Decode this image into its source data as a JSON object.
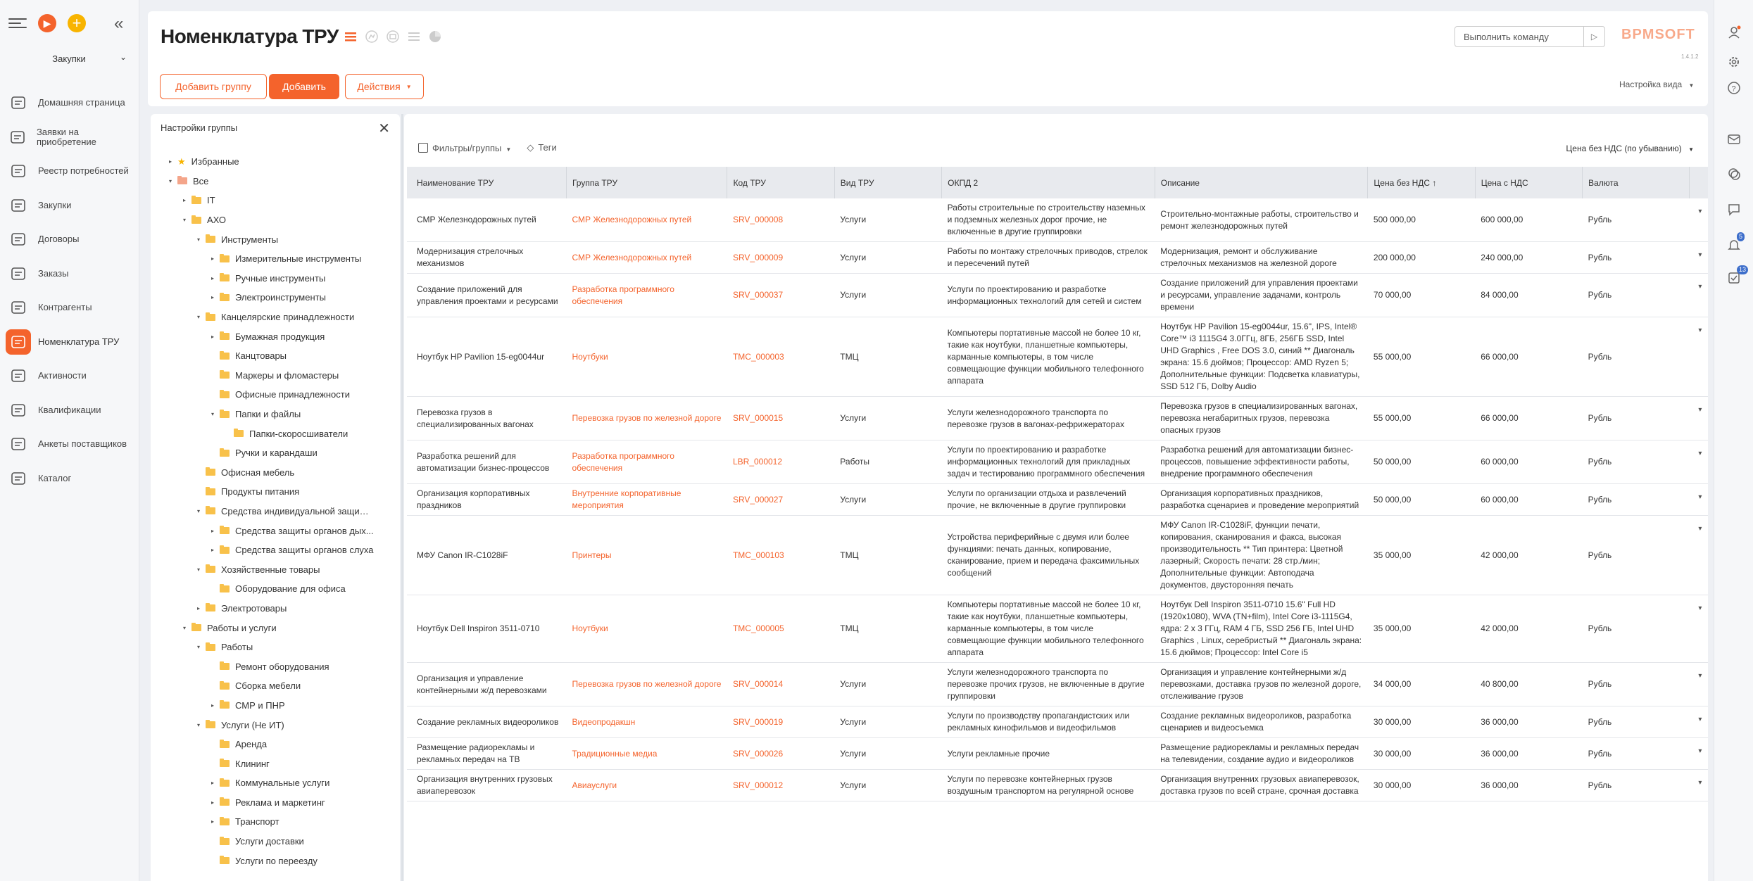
{
  "sidebar": {
    "section": "Закупки",
    "items": [
      {
        "label": "Домашняя страница",
        "icon": "home-icon"
      },
      {
        "label": "Заявки на приобретение",
        "icon": "cart-request-icon"
      },
      {
        "label": "Реестр потребностей",
        "icon": "list-icon"
      },
      {
        "label": "Закупки",
        "icon": "basket-icon"
      },
      {
        "label": "Договоры",
        "icon": "contract-icon"
      },
      {
        "label": "Заказы",
        "icon": "cart-icon"
      },
      {
        "label": "Контрагенты",
        "icon": "document-icon"
      },
      {
        "label": "Номенклатура ТРУ",
        "icon": "catalog-icon"
      },
      {
        "label": "Активности",
        "icon": "flag-icon"
      },
      {
        "label": "Квалификации",
        "icon": "qualification-icon"
      },
      {
        "label": "Анкеты поставщиков",
        "icon": "forms-icon"
      },
      {
        "label": "Каталог",
        "icon": "list-box-icon"
      }
    ]
  },
  "header": {
    "title": "Номенклатура ТРУ",
    "add_group": "Добавить группу",
    "add": "Добавить",
    "actions": "Действия",
    "command_placeholder": "Выполнить команду",
    "logo": "BPMSOFT",
    "version": "1.4.1.2",
    "view_settings": "Настройка вида"
  },
  "groups": {
    "title": "Настройки группы",
    "tree": [
      {
        "label": "Избранные",
        "level": 0,
        "arrow": "▸",
        "icon": "star"
      },
      {
        "label": "Все",
        "level": 0,
        "arrow": "▾",
        "icon": "red"
      },
      {
        "label": "IT",
        "level": 1,
        "arrow": "▸",
        "icon": "folder"
      },
      {
        "label": "АХО",
        "level": 1,
        "arrow": "▾",
        "icon": "folder"
      },
      {
        "label": "Инструменты",
        "level": 2,
        "arrow": "▾",
        "icon": "folder"
      },
      {
        "label": "Измерительные инструменты",
        "level": 3,
        "arrow": "▸",
        "icon": "folder"
      },
      {
        "label": "Ручные инструменты",
        "level": 3,
        "arrow": "▸",
        "icon": "folder"
      },
      {
        "label": "Электроинструменты",
        "level": 3,
        "arrow": "▸",
        "icon": "folder"
      },
      {
        "label": "Канцелярские принадлежности",
        "level": 2,
        "arrow": "▾",
        "icon": "folder"
      },
      {
        "label": "Бумажная продукция",
        "level": 3,
        "arrow": "▸",
        "icon": "folder"
      },
      {
        "label": "Канцтовары",
        "level": 3,
        "arrow": "",
        "icon": "folder"
      },
      {
        "label": "Маркеры и фломастеры",
        "level": 3,
        "arrow": "",
        "icon": "folder"
      },
      {
        "label": "Офисные принадлежности",
        "level": 3,
        "arrow": "",
        "icon": "folder"
      },
      {
        "label": "Папки и файлы",
        "level": 3,
        "arrow": "▾",
        "icon": "folder"
      },
      {
        "label": "Папки-скоросшиватели",
        "level": 4,
        "arrow": "",
        "icon": "folder"
      },
      {
        "label": "Ручки и карандаши",
        "level": 3,
        "arrow": "",
        "icon": "folder"
      },
      {
        "label": "Офисная мебель",
        "level": 2,
        "arrow": "",
        "icon": "folder"
      },
      {
        "label": "Продукты питания",
        "level": 2,
        "arrow": "",
        "icon": "folder"
      },
      {
        "label": "Средства индивидуальной защиты",
        "level": 2,
        "arrow": "▾",
        "icon": "folder"
      },
      {
        "label": "Средства защиты органов дых...",
        "level": 3,
        "arrow": "▸",
        "icon": "folder"
      },
      {
        "label": "Средства защиты органов слуха",
        "level": 3,
        "arrow": "▸",
        "icon": "folder"
      },
      {
        "label": "Хозяйственные товары",
        "level": 2,
        "arrow": "▾",
        "icon": "folder"
      },
      {
        "label": "Оборудование для офиса",
        "level": 3,
        "arrow": "",
        "icon": "folder"
      },
      {
        "label": "Электротовары",
        "level": 2,
        "arrow": "▸",
        "icon": "folder"
      },
      {
        "label": "Работы и услуги",
        "level": 1,
        "arrow": "▾",
        "icon": "folder"
      },
      {
        "label": "Работы",
        "level": 2,
        "arrow": "▾",
        "icon": "folder"
      },
      {
        "label": "Ремонт оборудования",
        "level": 3,
        "arrow": "",
        "icon": "folder"
      },
      {
        "label": "Сборка мебели",
        "level": 3,
        "arrow": "",
        "icon": "folder"
      },
      {
        "label": "СМР и ПНР",
        "level": 3,
        "arrow": "▸",
        "icon": "folder"
      },
      {
        "label": "Услуги (Не ИТ)",
        "level": 2,
        "arrow": "▾",
        "icon": "folder"
      },
      {
        "label": "Аренда",
        "level": 3,
        "arrow": "",
        "icon": "folder"
      },
      {
        "label": "Клининг",
        "level": 3,
        "arrow": "",
        "icon": "folder"
      },
      {
        "label": "Коммунальные услуги",
        "level": 3,
        "arrow": "▸",
        "icon": "folder"
      },
      {
        "label": "Реклама и маркетинг",
        "level": 3,
        "arrow": "▸",
        "icon": "folder"
      },
      {
        "label": "Транспорт",
        "level": 3,
        "arrow": "▸",
        "icon": "folder"
      },
      {
        "label": "Услуги доставки",
        "level": 3,
        "arrow": "",
        "icon": "folder"
      },
      {
        "label": "Услуги по переезду",
        "level": 3,
        "arrow": "",
        "icon": "folder"
      }
    ]
  },
  "grid": {
    "filters": "Фильтры/группы",
    "tags": "Теги",
    "sort": "Цена без НДС (по убыванию)",
    "columns": [
      "Наименование ТРУ",
      "Группа ТРУ",
      "Код ТРУ",
      "Вид ТРУ",
      "ОКПД 2",
      "Описание",
      "Цена без НДС ↑",
      "Цена с НДС",
      "Валюта"
    ],
    "rows": [
      {
        "name": "СМР Железнодорожных путей",
        "group": "СМР Железнодорожных путей",
        "code": "SRV_000008",
        "type": "Услуги",
        "okpd": "Работы строительные по строительству наземных и подземных железных дорог прочие, не включенные в другие группировки",
        "desc": "Строительно-монтажные работы, строительство и ремонт железнодорожных путей",
        "price": "500 000,00",
        "price_vat": "600 000,00",
        "currency": "Рубль"
      },
      {
        "name": "Модернизация стрелочных механизмов",
        "group": "СМР Железнодорожных путей",
        "code": "SRV_000009",
        "type": "Услуги",
        "okpd": "Работы по монтажу стрелочных приводов, стрелок и пересечений путей",
        "desc": "Модернизация, ремонт и обслуживание стрелочных механизмов на железной дороге",
        "price": "200 000,00",
        "price_vat": "240 000,00",
        "currency": "Рубль"
      },
      {
        "name": "Создание приложений для управления проектами и ресурсами",
        "group": "Разработка программного обеспечения",
        "code": "SRV_000037",
        "type": "Услуги",
        "okpd": "Услуги по проектированию и разработке информационных технологий для сетей и систем",
        "desc": "Создание приложений для управления проектами и ресурсами, управление задачами, контроль времени",
        "price": "70 000,00",
        "price_vat": "84 000,00",
        "currency": "Рубль"
      },
      {
        "name": "Ноутбук HP Pavilion 15-eg0044ur",
        "group": "Ноутбуки",
        "code": "TMC_000003",
        "type": "ТМЦ",
        "okpd": "Компьютеры портативные массой не более 10 кг, такие как ноутбуки, планшетные компьютеры, карманные компьютеры, в том числе совмещающие функции мобильного телефонного аппарата",
        "desc": "Ноутбук HP Pavilion 15-eg0044ur, 15.6\", IPS, Intel® Core™ i3 1115G4 3.0ГГц, 8ГБ, 256ГБ SSD, Intel UHD Graphics , Free DOS 3.0, синий ** Диагональ экрана: 15.6 дюймов; Процессор: AMD Ryzen 5; Дополнительные функции: Подсветка клавиатуры, SSD 512 ГБ, Dolby Audio",
        "price": "55 000,00",
        "price_vat": "66 000,00",
        "currency": "Рубль"
      },
      {
        "name": "Перевозка грузов в специализированных вагонах",
        "group": "Перевозка грузов по железной дороге",
        "code": "SRV_000015",
        "type": "Услуги",
        "okpd": "Услуги железнодорожного транспорта по перевозке грузов в вагонах-рефрижераторах",
        "desc": "Перевозка грузов в специализированных вагонах, перевозка негабаритных грузов, перевозка опасных грузов",
        "price": "55 000,00",
        "price_vat": "66 000,00",
        "currency": "Рубль"
      },
      {
        "name": "Разработка решений для автоматизации бизнес-процессов",
        "group": "Разработка программного обеспечения",
        "code": "LBR_000012",
        "type": "Работы",
        "okpd": "Услуги по проектированию и разработке информационных технологий для прикладных задач и тестированию программного обеспечения",
        "desc": "Разработка решений для автоматизации бизнес-процессов, повышение эффективности работы, внедрение программного обеспечения",
        "price": "50 000,00",
        "price_vat": "60 000,00",
        "currency": "Рубль"
      },
      {
        "name": "Организация корпоративных праздников",
        "group": "Внутренние корпоративные мероприятия",
        "code": "SRV_000027",
        "type": "Услуги",
        "okpd": "Услуги по организации отдыха и развлечений прочие, не включенные в другие группировки",
        "desc": "Организация корпоративных праздников, разработка сценариев и проведение мероприятий",
        "price": "50 000,00",
        "price_vat": "60 000,00",
        "currency": "Рубль"
      },
      {
        "name": "МФУ Canon IR-C1028iF",
        "group": "Принтеры",
        "code": "TMC_000103",
        "type": "ТМЦ",
        "okpd": "Устройства периферийные с двумя или более функциями: печать данных, копирование, сканирование, прием и передача факсимильных сообщений",
        "desc": "МФУ Canon IR-C1028iF, функции печати, копирования, сканирования и факса, высокая производительность ** Тип принтера: Цветной лазерный; Скорость печати: 28 стр./мин; Дополнительные функции: Автоподача документов, двусторонняя печать",
        "price": "35 000,00",
        "price_vat": "42 000,00",
        "currency": "Рубль"
      },
      {
        "name": "Ноутбук Dell Inspiron 3511-0710",
        "group": "Ноутбуки",
        "code": "TMC_000005",
        "type": "ТМЦ",
        "okpd": "Компьютеры портативные массой не более 10 кг, такие как ноутбуки, планшетные компьютеры, карманные компьютеры, в том числе совмещающие функции мобильного телефонного аппарата",
        "desc": "Ноутбук Dell Inspiron 3511-0710 15.6\" Full HD (1920x1080), WVA (TN+film), Intel Core i3-1115G4, ядра: 2 x 3 ГГц, RAM 4 ГБ, SSD 256 ГБ, Intel UHD Graphics , Linux, серебристый ** Диагональ экрана: 15.6 дюймов; Процессор: Intel Core i5",
        "price": "35 000,00",
        "price_vat": "42 000,00",
        "currency": "Рубль"
      },
      {
        "name": "Организация и управление контейнерными ж/д перевозками",
        "group": "Перевозка грузов по железной дороге",
        "code": "SRV_000014",
        "type": "Услуги",
        "okpd": "Услуги железнодорожного транспорта по перевозке прочих грузов, не включенные в другие группировки",
        "desc": "Организация и управление контейнерными ж/д перевозками, доставка грузов по железной дороге, отслеживание грузов",
        "price": "34 000,00",
        "price_vat": "40 800,00",
        "currency": "Рубль"
      },
      {
        "name": "Создание рекламных видеороликов",
        "group": "Видеопродакшн",
        "code": "SRV_000019",
        "type": "Услуги",
        "okpd": "Услуги по производству пропагандистских или рекламных кинофильмов и видеофильмов",
        "desc": "Создание рекламных видеороликов, разработка сценариев и видеосъемка",
        "price": "30 000,00",
        "price_vat": "36 000,00",
        "currency": "Рубль"
      },
      {
        "name": "Размещение радиорекламы и рекламных передач на ТВ",
        "group": "Традиционные медиа",
        "code": "SRV_000026",
        "type": "Услуги",
        "okpd": "Услуги рекламные прочие",
        "desc": "Размещение радиорекламы и рекламных передач на телевидении, создание аудио и видеороликов",
        "price": "30 000,00",
        "price_vat": "36 000,00",
        "currency": "Рубль"
      },
      {
        "name": "Организация внутренних грузовых авиаперевозок",
        "group": "Авиауслуги",
        "code": "SRV_000012",
        "type": "Услуги",
        "okpd": "Услуги по перевозке контейнерных грузов воздушным транспортом на регулярной основе",
        "desc": "Организация внутренних грузовых авиаперевозок, доставка грузов по всей стране, срочная доставка",
        "price": "30 000,00",
        "price_vat": "36 000,00",
        "currency": "Рубль"
      }
    ]
  },
  "right_bar": {
    "notifications_badge": "5",
    "tasks_badge": "13"
  }
}
